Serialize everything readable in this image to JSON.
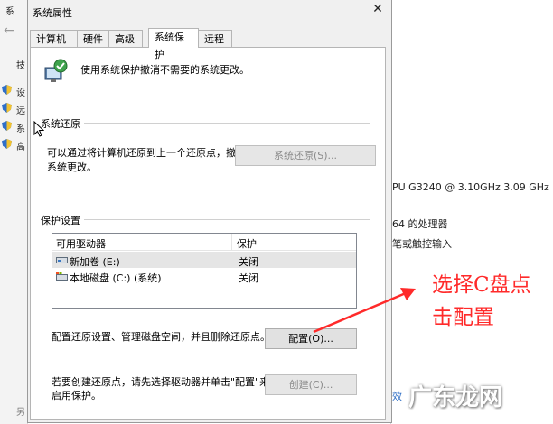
{
  "background": {
    "left_top": "系",
    "left_items": [
      "设",
      "远",
      "系",
      "高"
    ],
    "left_extra": "技",
    "left_bottom": "另",
    "right_lines": [
      "PU G3240 @ 3.10GHz   3.09 GHz",
      "64 的处理器",
      "笔或触控输入"
    ],
    "right_link": "效"
  },
  "dialog": {
    "title": "系统属性",
    "close_glyph": "✕",
    "tabs": [
      {
        "label": "计算机名"
      },
      {
        "label": "硬件"
      },
      {
        "label": "高级"
      },
      {
        "label": "系统保护"
      },
      {
        "label": "远程"
      }
    ],
    "intro_text": "使用系统保护撤消不需要的系统更改。",
    "restore": {
      "group_label": "系统还原",
      "text_line1": "可以通过将计算机还原到上一个还原点，撤消",
      "text_line2": "系统更改。",
      "button": "系统还原(S)..."
    },
    "protection": {
      "group_label": "保护设置",
      "columns": [
        "可用驱动器",
        "保护"
      ],
      "drives": [
        {
          "name": "新加卷 (E:)",
          "status": "关闭"
        },
        {
          "name": "本地磁盘 (C:) (系统)",
          "status": "关闭"
        }
      ],
      "config_text": "配置还原设置、管理磁盘空间，并且删除还原点。",
      "config_button": "配置(O)...",
      "create_text_line1": "若要创建还原点，请先选择驱动器并单击\"配置\"来",
      "create_text_line2": "启用保护。",
      "create_button": "创建(C)..."
    }
  },
  "annotation": {
    "line1": "选择C盘点",
    "line2": "击配置",
    "color": "#ff2a2a"
  },
  "watermark": "广东龙网"
}
